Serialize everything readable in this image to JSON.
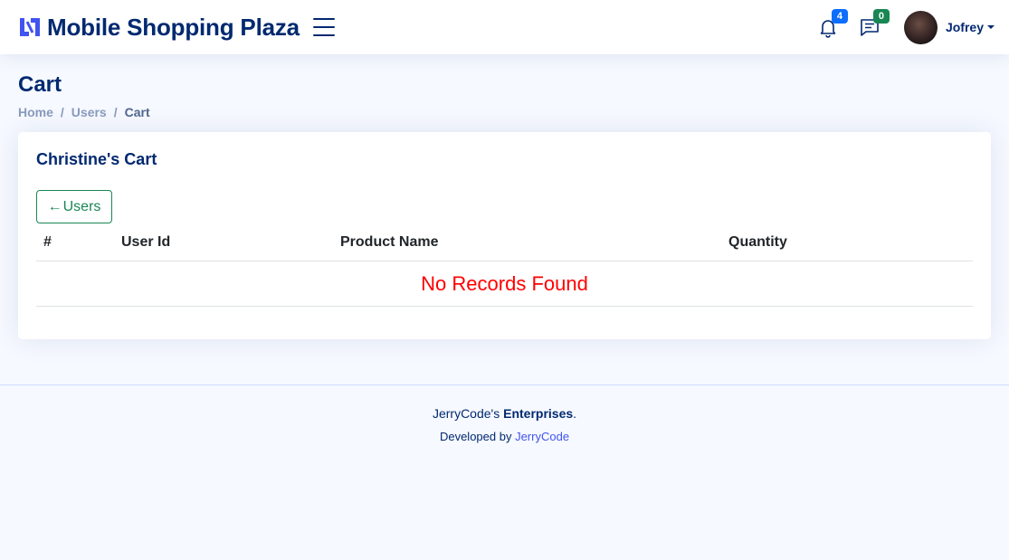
{
  "header": {
    "brand": "Mobile Shopping Plaza",
    "notifications_count": "4",
    "messages_count": "0",
    "profile_name": "Jofrey",
    "colors": {
      "brand": "#012970",
      "notif_badge": "#0d6efd",
      "msg_badge": "#198754"
    },
    "icons": [
      "logo-icon",
      "menu-icon",
      "bell-icon",
      "chat-icon",
      "caret-down-icon"
    ]
  },
  "page": {
    "title": "Cart",
    "breadcrumb": [
      "Home",
      "Users",
      "Cart"
    ]
  },
  "card": {
    "title": "Christine's Cart",
    "back_label": "Users",
    "back_arrow": "←",
    "columns": [
      "#",
      "User Id",
      "Product Name",
      "Quantity"
    ],
    "empty_message": "No Records Found",
    "empty_color": "#ff0000"
  },
  "footer": {
    "company_prefix": "JerryCode's",
    "company_name": "Enterprises",
    "developed_by_label": "Developed by",
    "developer": "JerryCode"
  }
}
